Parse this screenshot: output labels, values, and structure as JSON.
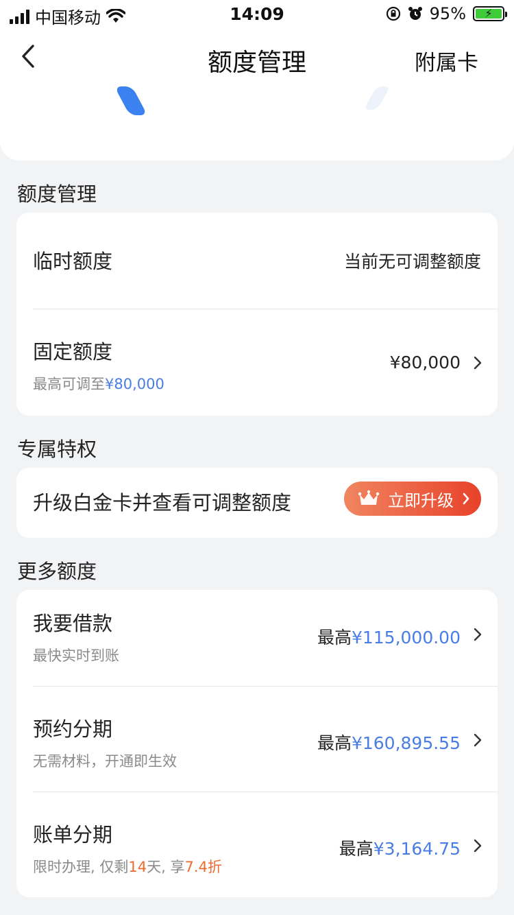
{
  "status_bar": {
    "carrier": "中国移动",
    "time": "14:09",
    "battery": "95%"
  },
  "nav": {
    "title": "额度管理",
    "right_action": "附属卡"
  },
  "sections": {
    "limit_management": {
      "title": "额度管理",
      "temporary": {
        "label": "临时额度",
        "value": "当前无可调整额度"
      },
      "fixed": {
        "label": "固定额度",
        "sub_prefix": "最高可调至",
        "sub_amount": "¥80,000",
        "value": "¥80,000"
      }
    },
    "privilege": {
      "title": "专属特权",
      "text": "升级白金卡并查看可调整额度",
      "button_label": "立即升级"
    },
    "more_limits": {
      "title": "更多额度",
      "items": [
        {
          "label": "我要借款",
          "sub": "最快实时到账",
          "prefix": "最高",
          "amount": "¥115,000.00"
        },
        {
          "label": "预约分期",
          "sub": "无需材料，开通即生效",
          "prefix": "最高",
          "amount": "¥160,895.55"
        },
        {
          "label": "账单分期",
          "sub_a": "限时办理, 仅剩",
          "sub_days": "14",
          "sub_b": "天, 享",
          "sub_discount": "7.4折",
          "prefix": "最高",
          "amount": "¥3,164.75"
        }
      ]
    }
  },
  "colors": {
    "accent_blue": "#4a7de3",
    "accent_orange": "#ee6b2f",
    "button_gradient_start": "#f08560",
    "button_gradient_end": "#e8422a",
    "background": "#f2f3f5"
  }
}
